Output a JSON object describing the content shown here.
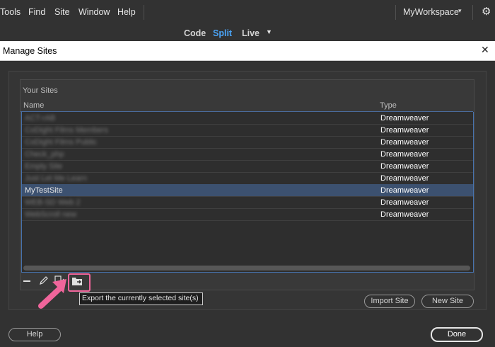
{
  "menubar": {
    "items": [
      "Tools",
      "Find",
      "Site",
      "Window",
      "Help"
    ],
    "workspace": "MyWorkspace",
    "workspace_caret": "▾",
    "settings_icon": "gear-icon"
  },
  "viewbar": {
    "code": "Code",
    "split": "Split",
    "live": "Live",
    "split_color": "#4aa3f5"
  },
  "dialog": {
    "title": "Manage Sites",
    "close_label": "✕",
    "your_sites_label": "Your Sites",
    "columns": {
      "name": "Name",
      "type": "Type"
    },
    "rows": [
      {
        "name": "ACT-rAB",
        "type": "Dreamweaver",
        "blurred": true
      },
      {
        "name": "CoDight Films Members",
        "type": "Dreamweaver",
        "blurred": true
      },
      {
        "name": "CoDight Films Public",
        "type": "Dreamweaver",
        "blurred": true
      },
      {
        "name": "Check_php",
        "type": "Dreamweaver",
        "blurred": true
      },
      {
        "name": "Empty Site",
        "type": "Dreamweaver",
        "blurred": true
      },
      {
        "name": "Just Let Me Learn",
        "type": "Dreamweaver",
        "blurred": true
      },
      {
        "name": "MyTestSite",
        "type": "Dreamweaver",
        "blurred": false,
        "selected": true
      },
      {
        "name": "WEB-SD Web 2",
        "type": "Dreamweaver",
        "blurred": true
      },
      {
        "name": "WebScroll new",
        "type": "Dreamweaver",
        "blurred": true
      }
    ],
    "toolbar_icons": [
      "minus-icon",
      "pencil-icon",
      "duplicate-icon",
      "export-icon"
    ],
    "tooltip": "Export the currently selected site(s)",
    "import_button": "Import Site",
    "new_button": "New Site",
    "help_button": "Help",
    "done_button": "Done",
    "highlight_color": "#f0659b",
    "selected_row_color": "#3c5170"
  }
}
